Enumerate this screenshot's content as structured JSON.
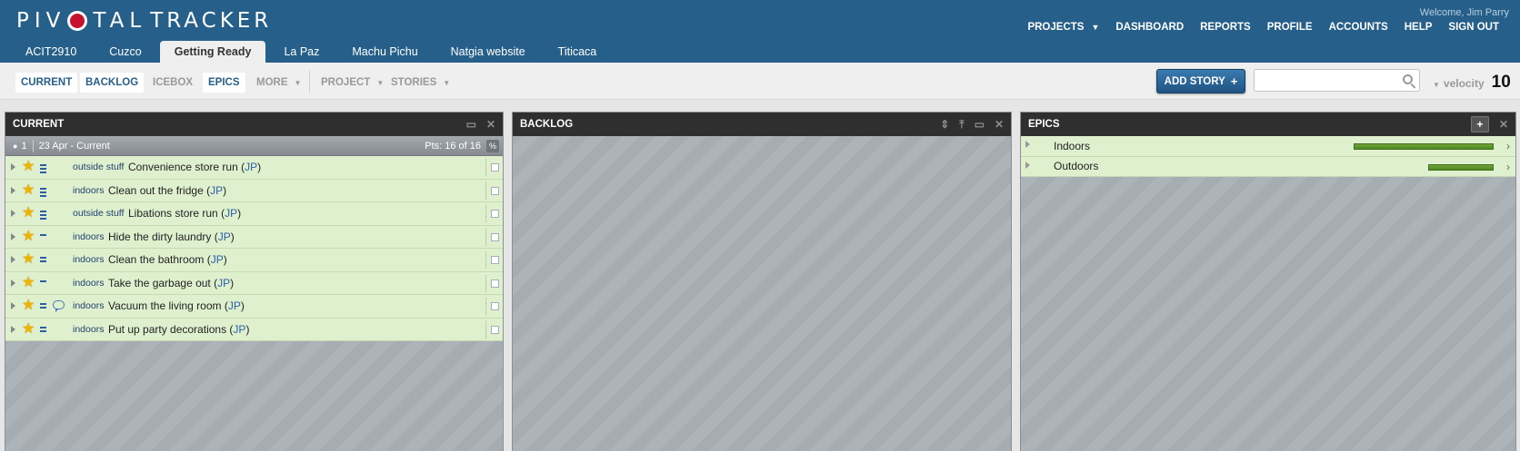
{
  "header": {
    "logo_pivotal": "PIV",
    "logo_tal": "TAL",
    "logo_tracker": "TRACKER",
    "welcome": "Welcome, Jim Parry",
    "nav": [
      "PROJECTS",
      "DASHBOARD",
      "REPORTS",
      "PROFILE",
      "ACCOUNTS",
      "HELP",
      "SIGN OUT"
    ],
    "tabs": [
      "ACIT2910",
      "Cuzco",
      "Getting Ready",
      "La Paz",
      "Machu Pichu",
      "Natgia website",
      "Titicaca"
    ],
    "active_tab": "Getting Ready"
  },
  "toolbar": {
    "current": "CURRENT",
    "backlog": "BACKLOG",
    "icebox": "ICEBOX",
    "epics": "EPICS",
    "more": "MORE",
    "project": "PROJECT",
    "stories": "STORIES",
    "add_story": "ADD STORY",
    "search_placeholder": "",
    "velocity_label": "velocity",
    "velocity_value": "10"
  },
  "panels": {
    "current": {
      "title": "CURRENT",
      "iteration": {
        "number": "1",
        "date": "23 Apr - Current",
        "points": "Pts: 16 of 16",
        "pct": "%"
      },
      "stories": [
        {
          "label": "outside stuff",
          "title": "Convenience store run",
          "owner": "JP",
          "estimate": 3,
          "comment": false
        },
        {
          "label": "indoors",
          "title": "Clean out the fridge",
          "owner": "JP",
          "estimate": 3,
          "comment": false
        },
        {
          "label": "outside stuff",
          "title": "Libations store run",
          "owner": "JP",
          "estimate": 3,
          "comment": false
        },
        {
          "label": "indoors",
          "title": "Hide the dirty laundry",
          "owner": "JP",
          "estimate": 1,
          "comment": false
        },
        {
          "label": "indoors",
          "title": "Clean the bathroom",
          "owner": "JP",
          "estimate": 2,
          "comment": false
        },
        {
          "label": "indoors",
          "title": "Take the garbage out",
          "owner": "JP",
          "estimate": 1,
          "comment": false
        },
        {
          "label": "indoors",
          "title": "Vacuum the living room",
          "owner": "JP",
          "estimate": 2,
          "comment": true
        },
        {
          "label": "indoors",
          "title": "Put up party decorations",
          "owner": "JP",
          "estimate": 2,
          "comment": false
        }
      ]
    },
    "backlog": {
      "title": "BACKLOG"
    },
    "epics": {
      "title": "EPICS",
      "items": [
        {
          "name": "Indoors",
          "progress": 1.0
        },
        {
          "name": "Outdoors",
          "progress": 0.47
        }
      ]
    }
  },
  "colors": {
    "header_bg": "#265f8a",
    "story_bg": "#dff0cf",
    "accent_blue": "#2a5ea8",
    "progress_green": "#5a9428"
  }
}
